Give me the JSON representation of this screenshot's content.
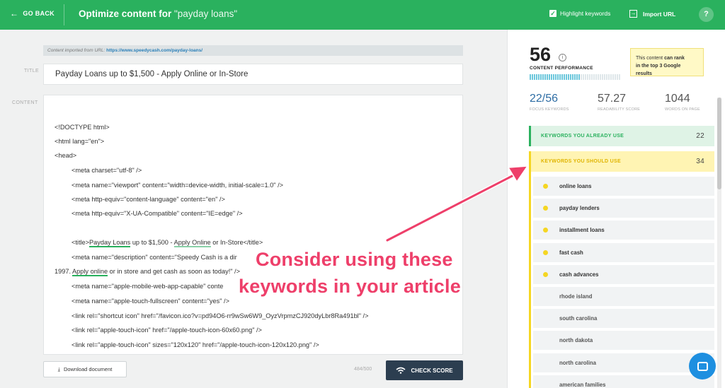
{
  "header": {
    "back_label": "GO BACK",
    "title_main": "Optimize content for ",
    "title_query": "\"payday loans\"",
    "highlight_label": "Highlight keywords",
    "import_label": "Import URL",
    "help_label": "?"
  },
  "editor": {
    "imported_prefix": "Content imported from URL:",
    "imported_url": "https://www.speedycash.com/payday-loans/",
    "title_label": "TITLE",
    "title_value": "Payday Loans up to $1,500 - Apply Online or In-Store",
    "content_label": "CONTENT",
    "lines": [
      "<!DOCTYPE html>",
      "<html lang=\"en\">",
      "<head>",
      "<meta charset=\"utf-8\" />",
      "<meta name=\"viewport\" content=\"width=device-width, initial-scale=1.0\" />",
      "<meta http-equiv=\"content-language\" content=\"en\" />",
      "<meta http-equiv=\"X-UA-Compatible\" content=\"IE=edge\" />",
      "<meta name=\"apple-mobile-web-app-capable\" conte",
      "<meta name=\"apple-touch-fullscreen\" content=\"yes\" />",
      "<link rel=\"shortcut icon\" href=\"/favicon.ico?v=pd94O6-rr9wSw6W9_OyzVrpmzCJ920dyLbr8Ra491bl\" />",
      "<link rel=\"apple-touch-icon\" href=\"/apple-touch-icon-60x60.png\" />",
      "<link rel=\"apple-touch-icon\" sizes=\"120x120\" href=\"/apple-touch-icon-120x120.png\" />"
    ],
    "title_tag": {
      "open": "<title>",
      "kw1": "Payday Loans",
      "mid1": " up to $1,500 - ",
      "kw2": "Apply Online",
      "mid2": " or In-Store</title>"
    },
    "desc_line": {
      "text": "<meta name=\"description\" content=\"Speedy Cash is a dir"
    },
    "wrap_line": {
      "pre": "1997. ",
      "kw": "Apply online",
      "post": " or in store and get cash as soon as today!\" />"
    },
    "download_label": "Download document",
    "char_count": "484/500",
    "check_label": "CHECK SCORE"
  },
  "annotation": {
    "line1": "Consider using these",
    "line2": "keywords in your article"
  },
  "panel": {
    "score": "56",
    "performance_label": "CONTENT PERFORMANCE",
    "performance_fraction": 0.56,
    "rank_text_1": "This content ",
    "rank_bold_1": "can rank",
    "rank_bold_2": "in the top 3 Google results",
    "stats": [
      {
        "value": "22/56",
        "label": "FOCUS KEYWORDS"
      },
      {
        "value": "57.27",
        "label": "READABILITY SCORE"
      },
      {
        "value": "1044",
        "label": "WORDS ON PAGE"
      }
    ],
    "already_label": "KEYWORDS YOU ALREADY USE",
    "already_count": "22",
    "should_label": "KEYWORDS YOU SHOULD USE",
    "should_count": "34",
    "keywords": [
      {
        "text": "online loans",
        "dot": true
      },
      {
        "text": "payday lenders",
        "dot": true
      },
      {
        "text": "installment loans",
        "dot": true
      },
      {
        "text": "fast cash",
        "dot": true
      },
      {
        "text": "cash advances",
        "dot": true
      },
      {
        "text": "rhode island",
        "dot": false
      },
      {
        "text": "south carolina",
        "dot": false
      },
      {
        "text": "north dakota",
        "dot": false
      },
      {
        "text": "north carolina",
        "dot": false
      },
      {
        "text": "american families",
        "dot": false
      }
    ]
  },
  "colors": {
    "brand_green": "#2ab15e",
    "dark_button": "#2c3e50",
    "yellow_accent": "#f5d623",
    "annotation_pink": "#ee3f6a",
    "chat_blue": "#1e8fe0"
  }
}
